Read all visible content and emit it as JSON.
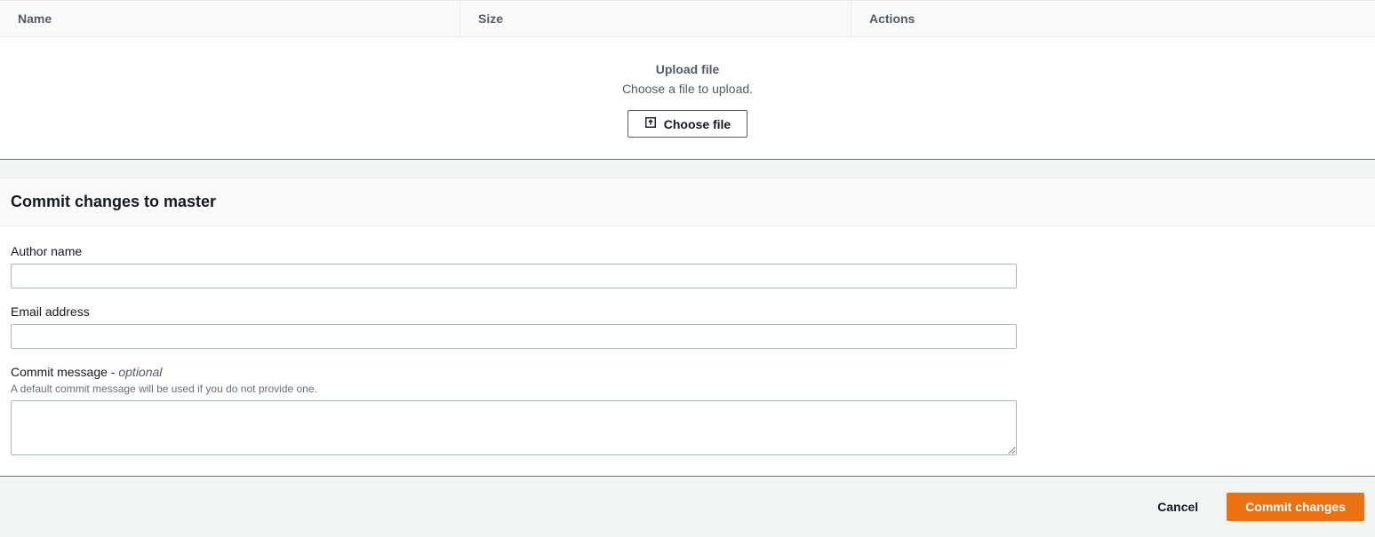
{
  "table": {
    "headers": {
      "name": "Name",
      "size": "Size",
      "actions": "Actions"
    }
  },
  "upload": {
    "title": "Upload file",
    "subtitle": "Choose a file to upload.",
    "button_label": "Choose file"
  },
  "commit": {
    "heading": "Commit changes to master",
    "author_name": {
      "label": "Author name",
      "value": ""
    },
    "email": {
      "label": "Email address",
      "value": ""
    },
    "message": {
      "label": "Commit message - ",
      "optional": "optional",
      "hint": "A default commit message will be used if you do not provide one.",
      "value": ""
    }
  },
  "footer": {
    "cancel_label": "Cancel",
    "commit_label": "Commit changes"
  }
}
